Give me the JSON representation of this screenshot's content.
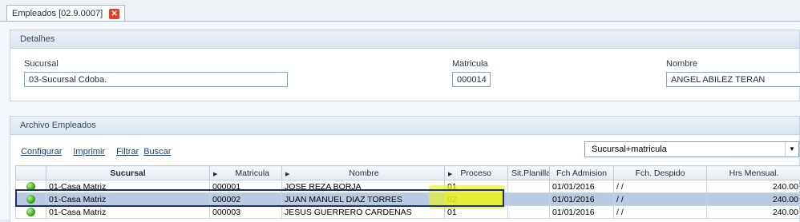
{
  "tab": {
    "title": "Empleados [02.9.0007]",
    "close": "✕"
  },
  "detalhes": {
    "title": "Detalhes",
    "sucursal": {
      "label": "Sucursal",
      "value": "03-Sucursal Cdoba."
    },
    "matricula": {
      "label": "Matricula",
      "value": "000014"
    },
    "nombre": {
      "label": "Nombre",
      "value": "ANGEL ABILEZ TERAN"
    }
  },
  "archivo": {
    "title": "Archivo Empleados",
    "links": [
      "Configurar",
      "Imprimir",
      "Filtrar",
      "Buscar"
    ],
    "order_select": "Sucursal+matricula",
    "columns": [
      "",
      "Sucursal",
      "Matricula",
      "Nombre",
      "Proceso",
      "Sit.Planilla",
      "Fch Admision",
      "Fch. Despido",
      "Hrs Mensual."
    ],
    "rows": [
      {
        "sucursal": "01-Casa Matriz",
        "matricula": "000001",
        "nombre": "JOSE REZA BORJA",
        "proceso": "01",
        "sit": "",
        "admision": "01/01/2016",
        "despido": " / /",
        "hrs": "240.00"
      },
      {
        "sucursal": "01-Casa Matriz",
        "matricula": "000002",
        "nombre": "JUAN MANUEL DIAZ TORRES",
        "proceso": "02",
        "sit": "",
        "admision": "01/01/2016",
        "despido": " / /",
        "hrs": "240.00"
      },
      {
        "sucursal": "01-Casa Matriz",
        "matricula": "000003",
        "nombre": "JESUS GUERRERO CARDENAS",
        "proceso": "01",
        "sit": "",
        "admision": "01/01/2016",
        "despido": " / /",
        "hrs": "240.00"
      }
    ]
  },
  "colors": {
    "status_dot": "#3aa41d",
    "selected_row": "#b9cbe3",
    "highlight": "#e6f028",
    "tab_close": "#e0402a"
  }
}
